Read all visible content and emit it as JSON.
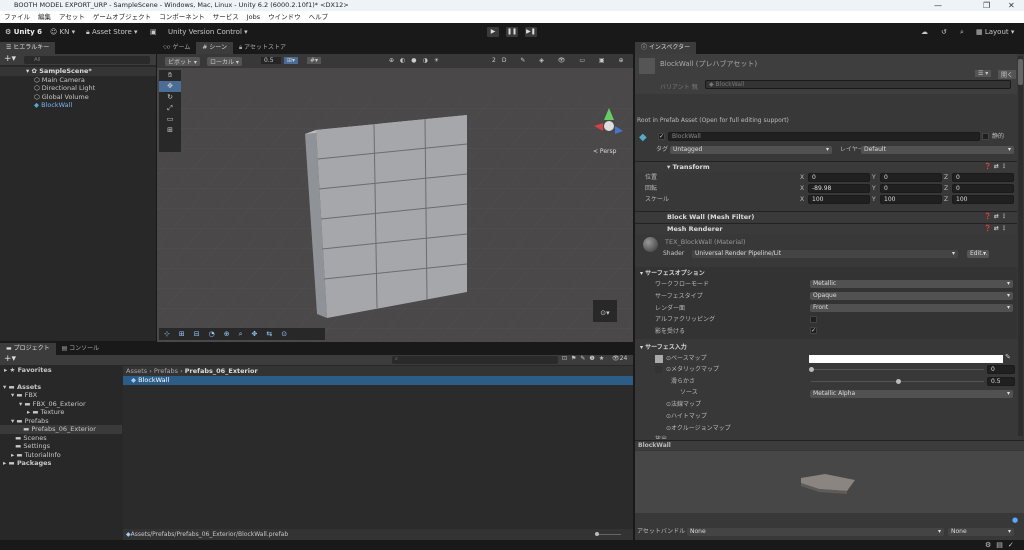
{
  "window": {
    "title": "BOOTH MODEL EXPORT_URP - SampleScene - Windows, Mac, Linux - Unity 6.2 (6000.2.10f1)* <DX12>",
    "minimize": "—",
    "maximize": "❐",
    "close": "✕"
  },
  "menu": [
    "ファイル",
    "編集",
    "アセット",
    "ゲームオブジェクト",
    "コンポーネント",
    "サービス",
    "Jobs",
    "ウインドウ",
    "ヘルプ"
  ],
  "toolbar": {
    "unity": "Unity 6",
    "account": "KN ▾",
    "asset_store": "Asset Store ▾",
    "version_control": "Unity Version Control ▾",
    "layout": "Layout ▾",
    "play": "▶",
    "pause": "❚❚",
    "step": "▶❚"
  },
  "hierarchy": {
    "tab": "ヒエラルキー",
    "search_placeholder": "All",
    "scene": "SampleScene*",
    "items": [
      "Main Camera",
      "Directional Light",
      "Global Volume",
      "BlockWall"
    ]
  },
  "scene": {
    "tabs": [
      "ゲーム",
      "シーン",
      "アセットストア"
    ],
    "pivot": "ピボット",
    "local": "ローカル",
    "snap": "0.5",
    "persp": "< Persp"
  },
  "inspector": {
    "tab": "インスペクター",
    "title": "BlockWall (プレハブアセット)",
    "open": "開く",
    "variant_label": "バリアント 親",
    "variant_value": "BlockWall",
    "root_note": "Root in Prefab Asset (Open for full editing support)",
    "name": "BlockWall",
    "static": "静的",
    "tag_label": "タグ",
    "tag": "Untagged",
    "layer_label": "レイヤー",
    "layer": "Default",
    "transform": {
      "title": "Transform",
      "rows": [
        {
          "label": "位置",
          "x": "0",
          "y": "0",
          "z": "0"
        },
        {
          "label": "回転",
          "x": "-89.98",
          "y": "0",
          "z": "0"
        },
        {
          "label": "スケール",
          "x": "100",
          "y": "100",
          "z": "100"
        }
      ]
    },
    "mesh_filter": "Block Wall (Mesh Filter)",
    "mesh_renderer": "Mesh Renderer",
    "material": "TEX_BlockWall (Material)",
    "shader_label": "Shader",
    "shader": "Universal Render Pipeline/Lit",
    "edit": "Edit...",
    "surface_options": {
      "title": "サーフェスオプション",
      "rows": [
        {
          "label": "ワークフローモード",
          "value": "Metallic"
        },
        {
          "label": "サーフェスタイプ",
          "value": "Opaque"
        },
        {
          "label": "レンダー面",
          "value": "Front"
        }
      ],
      "alpha_clip": "アルファクリッピング",
      "receive_shadows": "影を受ける"
    },
    "surface_inputs": {
      "title": "サーフェス入力",
      "base_map": "ベースマップ",
      "metallic_map": "メタリックマップ",
      "metallic_value": "0",
      "smoothness": "滑らかさ",
      "smoothness_value": "0.5",
      "smoothness_fraction": 0.5,
      "source_label": "ソース",
      "source": "Metallic Alpha",
      "normal_map": "法線マップ",
      "height_map": "ハイトマップ",
      "occlusion_map": "オクルージョンマップ",
      "emission": "放出"
    },
    "preview_title": "BlockWall",
    "asset_bundle_label": "アセットバンドル",
    "asset_bundle": "None",
    "asset_variant": "None"
  },
  "project": {
    "tabs": [
      "プロジェクト",
      "コンソール"
    ],
    "favorites": "Favorites",
    "tree": [
      {
        "label": "Assets",
        "depth": 0
      },
      {
        "label": "FBX",
        "depth": 1
      },
      {
        "label": "FBX_06_Exterior",
        "depth": 2
      },
      {
        "label": "Texture",
        "depth": 3
      },
      {
        "label": "Prefabs",
        "depth": 1
      },
      {
        "label": "Prefabs_06_Exterior",
        "depth": 2
      },
      {
        "label": "Scenes",
        "depth": 1
      },
      {
        "label": "Settings",
        "depth": 1
      },
      {
        "label": "TutorialInfo",
        "depth": 1
      },
      {
        "label": "Packages",
        "depth": 0
      }
    ],
    "breadcrumb": [
      "Assets",
      "Prefabs",
      "Prefabs_06_Exterior"
    ],
    "items": [
      "BlockWall"
    ],
    "path": "Assets/Prefabs/Prefabs_06_Exterior/BlockWall.prefab",
    "count": "24"
  }
}
